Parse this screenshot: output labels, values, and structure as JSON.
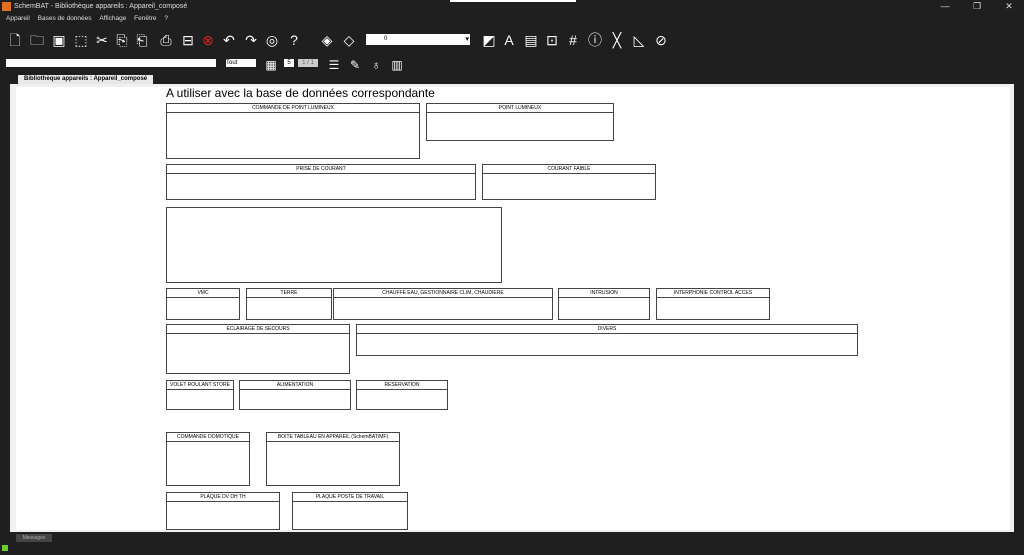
{
  "window": {
    "title": "SchemBAT - Bibliothèque appareils : Appareil_composé",
    "controls": [
      "—",
      "❐",
      "✕"
    ]
  },
  "menu": [
    "Appareil",
    "Bases de données",
    "Affichage",
    "Fenêtre",
    "?"
  ],
  "toolbar": {
    "layer_select_value": "0",
    "scope_value": "Tout",
    "page_value": "5",
    "page_count": "1 / 1"
  },
  "tab": {
    "label": "Bibliothèque appareils : Appareil_composé"
  },
  "canvas": {
    "heading": "A utiliser avec la base de données correspondante",
    "boxes": [
      {
        "label": "COMMANDE DE POINT LUMINEUX"
      },
      {
        "label": "POINT LUMINEUX"
      },
      {
        "label": "PRISE DE COURANT"
      },
      {
        "label": "COURANT FAIBLE"
      },
      {
        "label": "VMC"
      },
      {
        "label": "TERRE"
      },
      {
        "label": "CHAUFFE EAU, GESTIONNAIRE CLIM, CHAUDIERE"
      },
      {
        "label": "INTRUSION"
      },
      {
        "label": "INTERPHONIE CONTROL ACCES"
      },
      {
        "label": "ECLAIRAGE DE SECOURS"
      },
      {
        "label": "DIVERS"
      },
      {
        "label": "VOLET ROULANT STORE"
      },
      {
        "label": "ALIMENTATION"
      },
      {
        "label": "RESERVATION"
      },
      {
        "label": "COMMANDE DOMOTIQUE"
      },
      {
        "label": "BOITE TABLEAU EN APPAREIL (SchemBAT/MF)"
      },
      {
        "label": "PLAQUE DV DH TH"
      },
      {
        "label": "PLAQUE POSTE DE TRAVAIL"
      }
    ]
  },
  "status": {
    "messages_label": "Messages"
  }
}
